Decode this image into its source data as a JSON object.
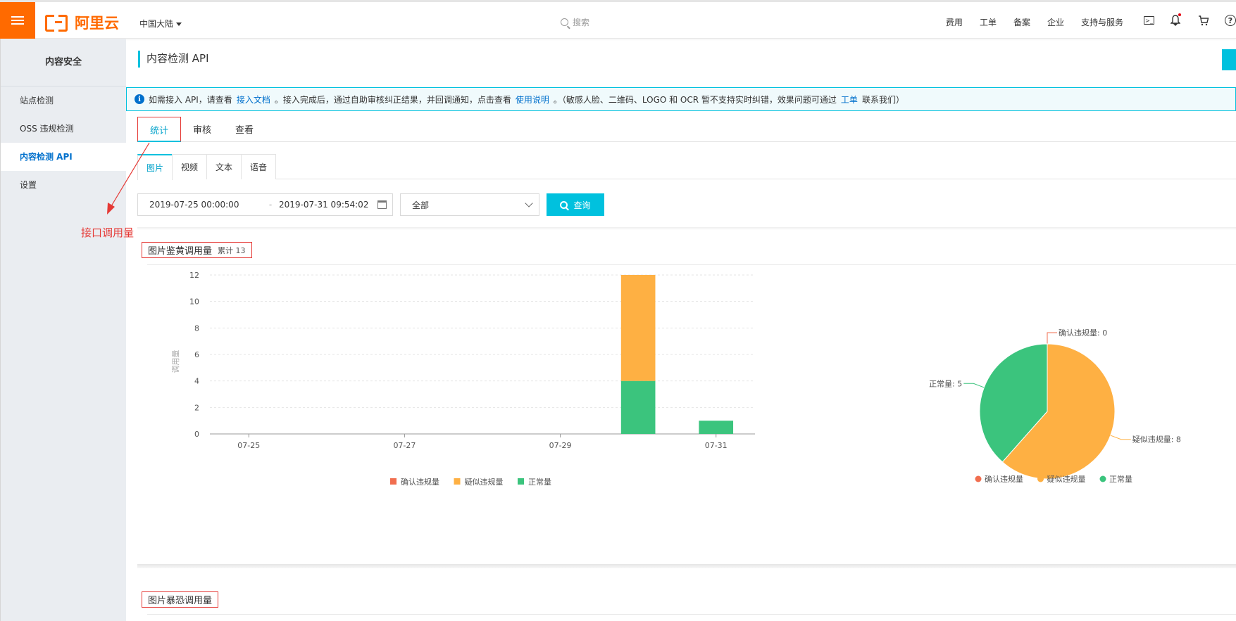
{
  "topbar": {
    "logo_text": "阿里云",
    "region": "中国大陆",
    "search_placeholder": "搜索",
    "links": [
      "费用",
      "工单",
      "备案",
      "企业",
      "支持与服务"
    ],
    "help_glyph": "?"
  },
  "sidebar": {
    "title": "内容安全",
    "items": [
      {
        "label": "站点检测"
      },
      {
        "label": "OSS 违规检测"
      },
      {
        "label": "内容检测 API"
      },
      {
        "label": "设置"
      }
    ]
  },
  "page": {
    "title": "内容检测 API",
    "notice": {
      "t1": "如需接入 API，请查看",
      "link1": "接入文档",
      "t2": "。接入完成后，通过自助审核纠正结果，并回调通知，点击查看",
      "link2": "使用说明",
      "t3": "。（敏感人脸、二维码、LOGO 和 OCR 暂不支持实时纠错，效果问题可通过",
      "link3": "工单",
      "t4": "联系我们）"
    },
    "tabs": [
      "统计",
      "审核",
      "查看"
    ],
    "subtabs": [
      "图片",
      "视频",
      "文本",
      "语音"
    ],
    "filters": {
      "start": "2019-07-25 00:00:00",
      "dash": "-",
      "end": "2019-07-31 09:54:02",
      "select_value": "全部",
      "query_label": "查询"
    },
    "annotation": "接口调用量",
    "section1": {
      "title": "图片鉴黄调用量",
      "total": "累计 13"
    },
    "section2": {
      "title": "图片暴恐调用量"
    }
  },
  "colors": {
    "confirmed": "#f16e4f",
    "suspected": "#feb043",
    "normal": "#3bc47d",
    "accent": "#00c1de",
    "brand": "#ff6a00"
  },
  "chart_data": [
    {
      "type": "bar",
      "stacked": true,
      "ylabel": "调用量",
      "categories": [
        "07-25",
        "07-26",
        "07-27",
        "07-28",
        "07-29",
        "07-30",
        "07-31"
      ],
      "x_tick_labels": [
        "07-25",
        "07-27",
        "07-29",
        "07-31"
      ],
      "ylim": [
        0,
        12
      ],
      "y_ticks": [
        0,
        2,
        4,
        6,
        8,
        10,
        12
      ],
      "grid": true,
      "series": [
        {
          "name": "确认违规量",
          "values": [
            0,
            0,
            0,
            0,
            0,
            0,
            0
          ]
        },
        {
          "name": "疑似违规量",
          "values": [
            0,
            0,
            0,
            0,
            0,
            8,
            0
          ]
        },
        {
          "name": "正常量",
          "values": [
            0,
            0,
            0,
            0,
            0,
            4,
            1
          ]
        }
      ],
      "legend_position": "bottom"
    },
    {
      "type": "pie",
      "slices": [
        {
          "name": "确认违规量",
          "value": 0,
          "label": "确认违规量: 0"
        },
        {
          "name": "疑似违规量",
          "value": 8,
          "label": "疑似违规量: 8"
        },
        {
          "name": "正常量",
          "value": 5,
          "label": "正常量: 5"
        }
      ],
      "legend_position": "bottom"
    }
  ]
}
